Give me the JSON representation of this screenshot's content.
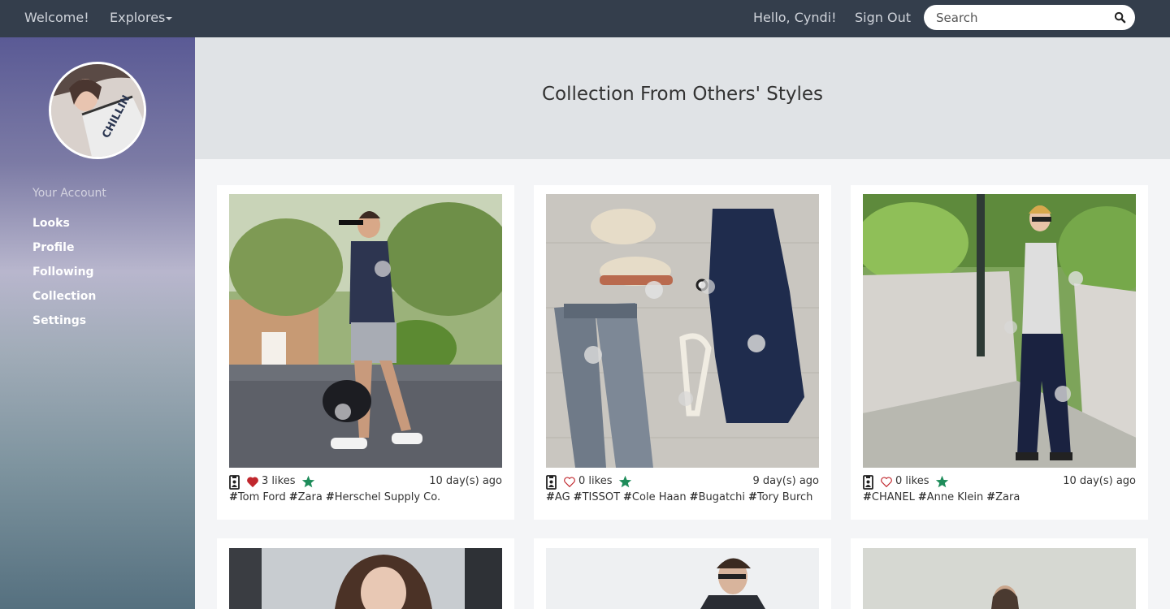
{
  "nav": {
    "welcome": "Welcome!",
    "explores": "Explores",
    "greeting": "Hello, Cyndi!",
    "sign_out": "Sign Out",
    "search_placeholder": "Search"
  },
  "sidebar": {
    "avatar_shirt_text": "CHILLIN",
    "heading": "Your Account",
    "items": [
      {
        "label": "Looks"
      },
      {
        "label": "Profile"
      },
      {
        "label": "Following"
      },
      {
        "label": "Collection"
      },
      {
        "label": "Settings"
      }
    ]
  },
  "header": {
    "title": "Collection From Others' Styles"
  },
  "cards": [
    {
      "likes": "3 likes",
      "liked": true,
      "posted": "10 day(s) ago",
      "tags": [
        "Tom Ford",
        "Zara",
        "Herschel Supply Co."
      ]
    },
    {
      "likes": "0 likes",
      "liked": false,
      "posted": "9 day(s) ago",
      "tags": [
        "AG",
        "TISSOT",
        "Cole Haan",
        "Bugatchi",
        "Tory Burch"
      ]
    },
    {
      "likes": "0 likes",
      "liked": false,
      "posted": "10 day(s) ago",
      "tags": [
        "CHANEL",
        "Anne Klein",
        "Zara"
      ]
    }
  ],
  "icons": {
    "search": "search-icon",
    "profile": "profile-badge-icon",
    "heart": "heart-icon",
    "star": "star-icon",
    "hash": "hash-icon"
  },
  "colors": {
    "navbar": "#343e4c",
    "heart": "#c0272d",
    "star": "#1e8c5a",
    "header_band": "#e0e3e6"
  }
}
